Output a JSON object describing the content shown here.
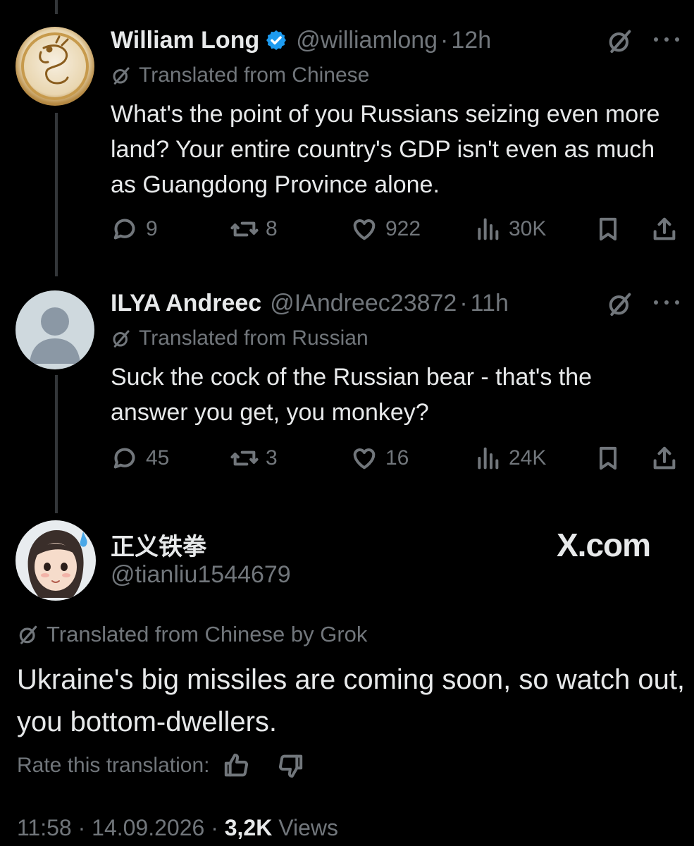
{
  "tweets": [
    {
      "name": "William Long",
      "verified": true,
      "handle": "@williamlong",
      "time": "12h",
      "translated": "Translated from Chinese",
      "text": "What's the point of you Russians seizing even more land? Your entire country's GDP isn't even as much as Guangdong Province alone.",
      "replies": "9",
      "reposts": "8",
      "likes": "922",
      "views": "30K"
    },
    {
      "name": "ILYA Andreec",
      "verified": false,
      "handle": "@IAndreec23872",
      "time": "11h",
      "translated": "Translated from Russian",
      "text": "Suck the cock of the Russian bear - that's the answer you get, you monkey?",
      "replies": "45",
      "reposts": "3",
      "likes": "16",
      "views": "24K"
    }
  ],
  "main": {
    "name": "正义铁拳",
    "handle": "@tianliu1544679",
    "watermark": "X.com",
    "translated": "Translated from Chinese by Grok",
    "text": "Ukraine's big missiles are coming soon, so watch out, you bottom-dwellers.",
    "rate_label": "Rate this translation:",
    "time": "11:58",
    "date": "14.09.2026",
    "views_count": "3,2K",
    "views_label": "Views"
  },
  "icons": {
    "reply": "speech-bubble-icon",
    "repost": "repost-arrows-icon",
    "like": "heart-icon",
    "views": "bar-chart-icon",
    "bookmark": "bookmark-icon",
    "share": "share-upload-icon",
    "grok": "grok-slash-icon",
    "more": "ellipsis-icon"
  },
  "colors": {
    "background": "#000000",
    "text": "#e7e9ea",
    "secondary": "#71767b",
    "verified": "#1d9bf0",
    "thread_line": "#333639"
  }
}
